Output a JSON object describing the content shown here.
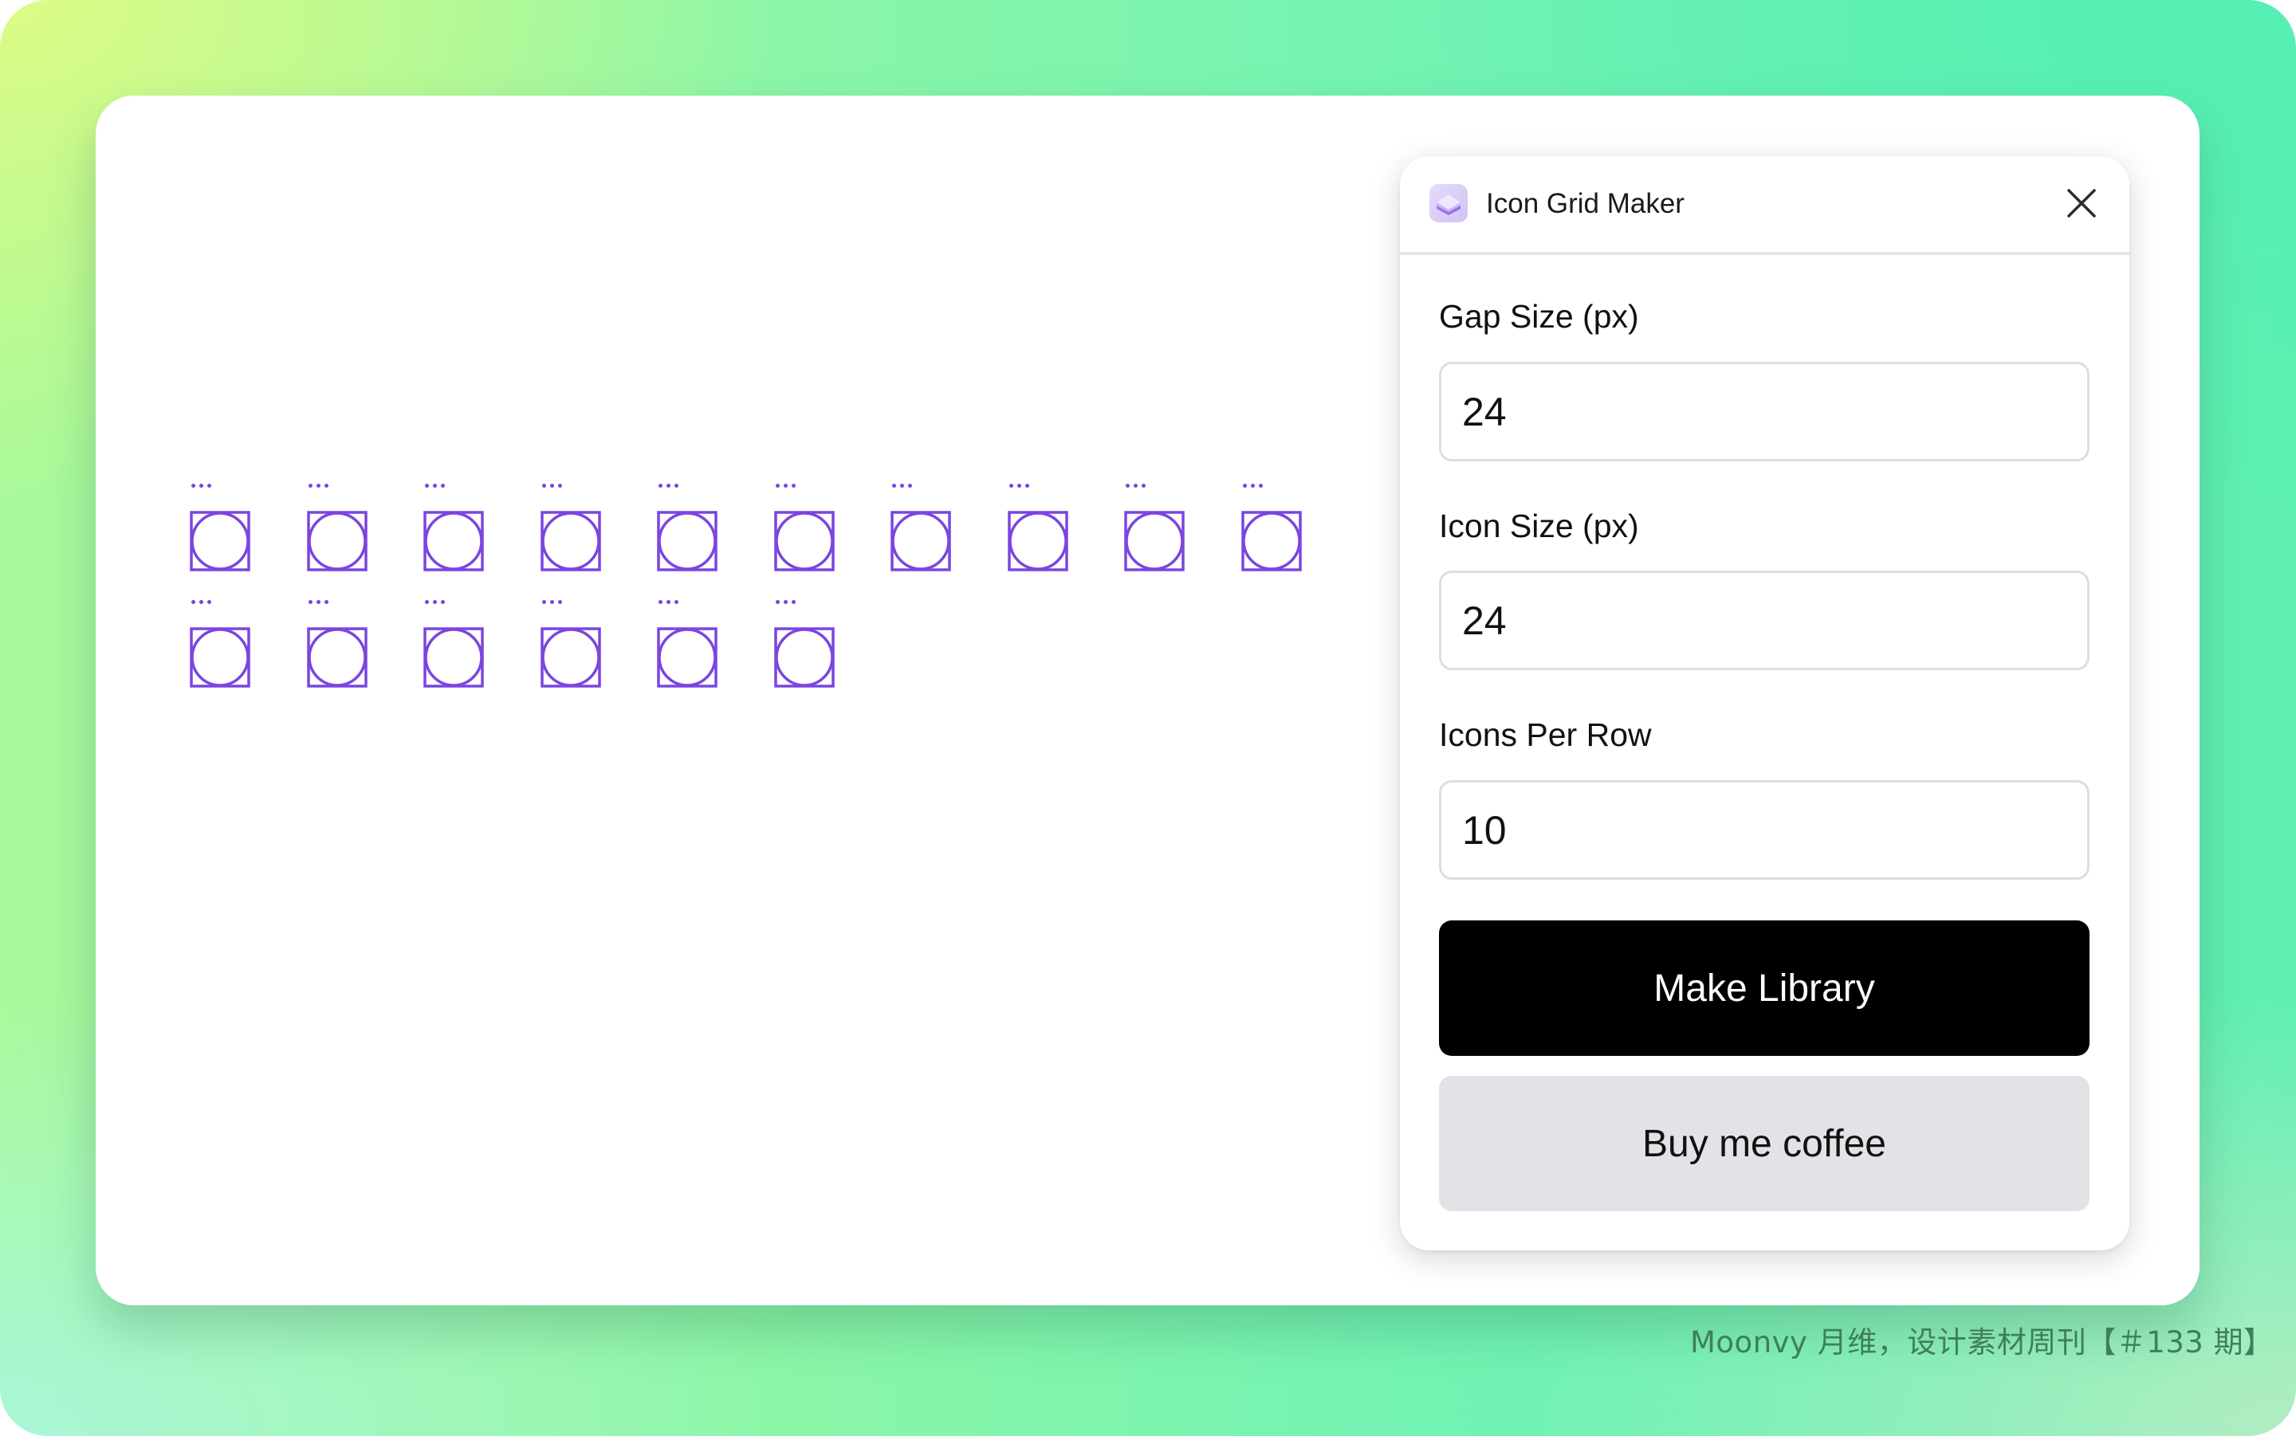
{
  "caption": "Moonvy 月维，设计素材周刊【＃133 期】",
  "colors": {
    "icon_stroke": "#7b45e0",
    "primary_button_bg": "#000000",
    "secondary_button_bg": "#e2e3e6",
    "caption_text": "#3e7f58"
  },
  "canvas": {
    "rows": [
      {
        "label": "...",
        "icon": "square-circle-icon",
        "count": 10
      },
      {
        "label": "...",
        "icon": "square-circle-icon",
        "count": 6
      }
    ],
    "total_icons": 16
  },
  "panel": {
    "app_icon": "stacked-layers-icon",
    "title": "Icon Grid Maker",
    "close_icon": "close-icon",
    "fields": [
      {
        "label": "Gap Size (px)",
        "value": "24"
      },
      {
        "label": "Icon Size (px)",
        "value": "24"
      },
      {
        "label": "Icons Per Row",
        "value": "10"
      }
    ],
    "buttons": {
      "primary": "Make Library",
      "secondary": "Buy me coffee"
    }
  }
}
